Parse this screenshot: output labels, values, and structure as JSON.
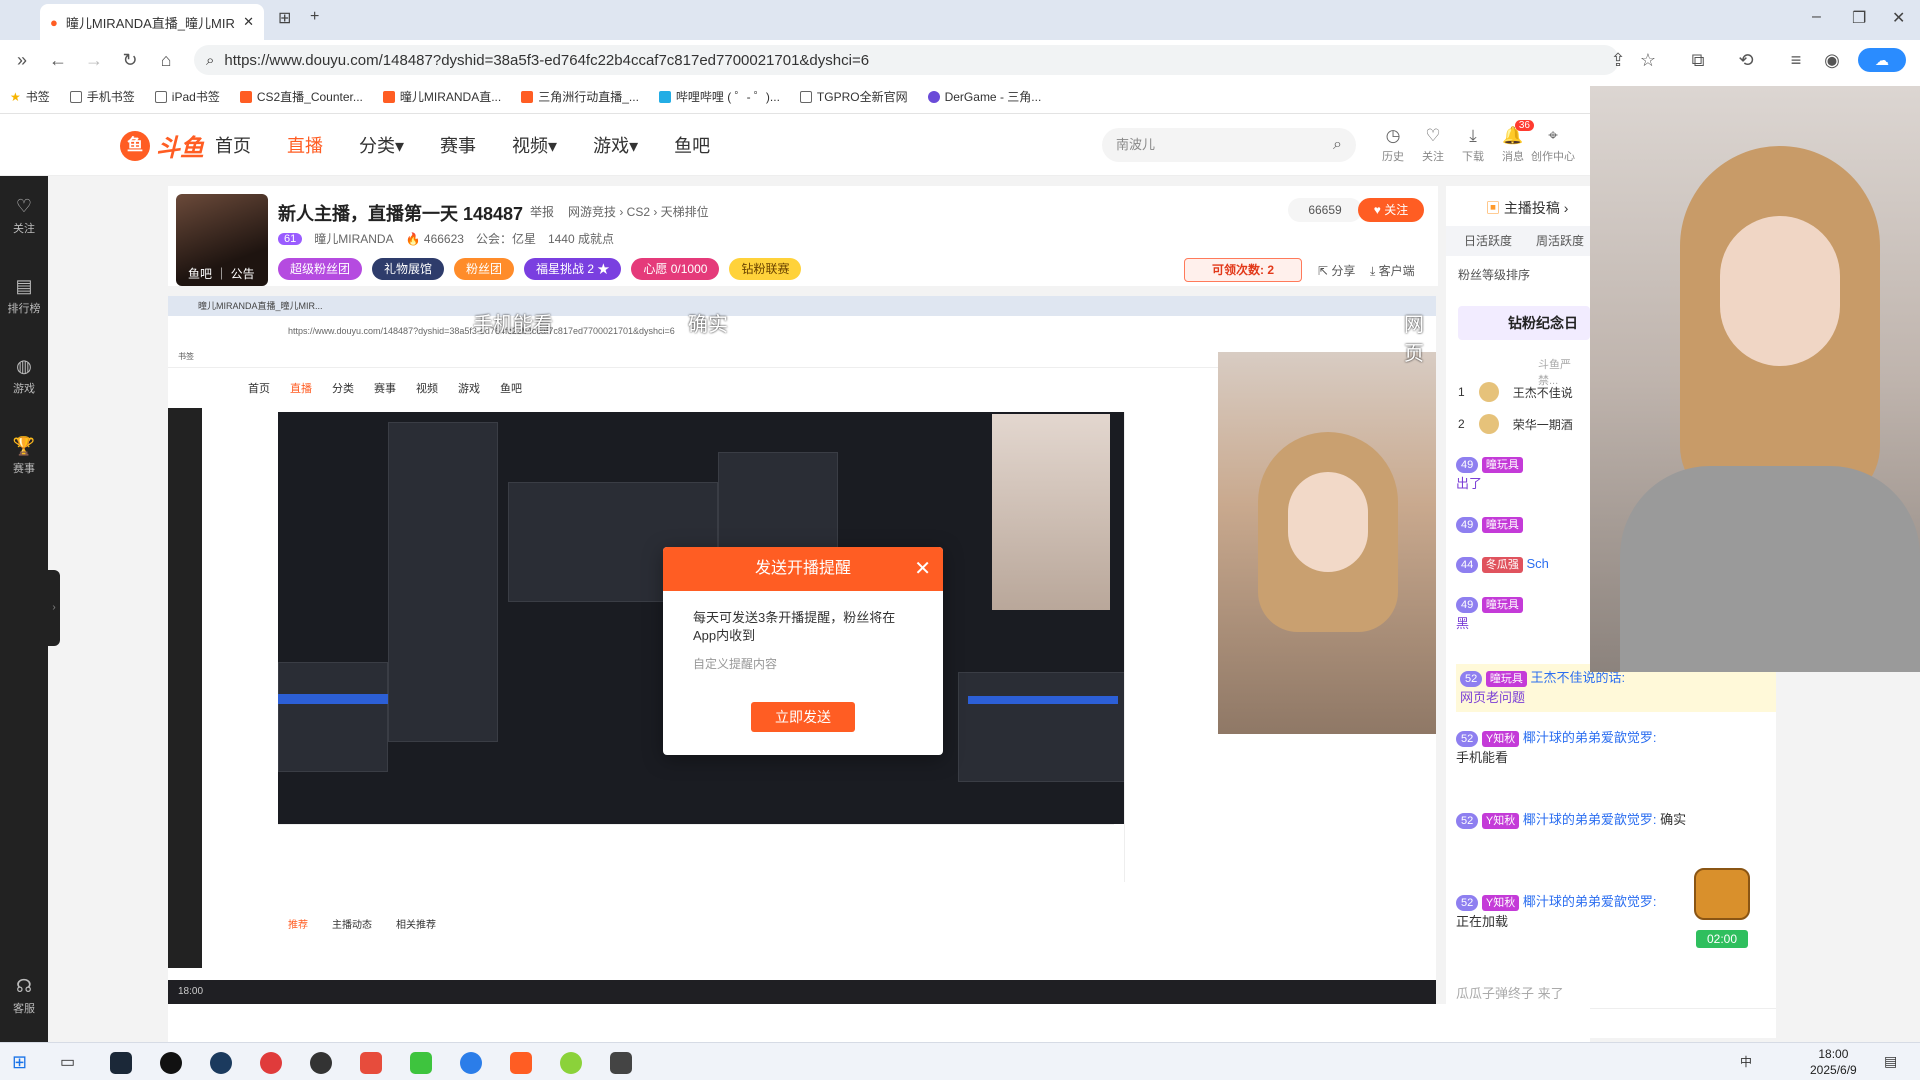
{
  "browser": {
    "tab_title": "曈儿MIRANDA直播_曈儿MIR...",
    "url": "https://www.douyu.com/148487?dyshid=38a5f3-ed764fc22b4ccaf7c817ed7700021701&dyshci=6",
    "bookmarks": [
      "书签",
      "手机书签",
      "iPad书签",
      "CS2直播_Counter...",
      "曈儿MIRANDA直...",
      "三角洲行动直播_...",
      "哔哩哔哩 ( ゜- ゜)...",
      "TGPRO全新官网",
      "DerGame - 三角..."
    ]
  },
  "site": {
    "logo_text": "斗鱼",
    "nav": [
      "首页",
      "直播",
      "分类▾",
      "赛事",
      "视频▾",
      "游戏▾",
      "鱼吧"
    ],
    "search_placeholder": "南波儿",
    "header_icons": [
      {
        "label": "历史",
        "icon": "clock-icon"
      },
      {
        "label": "关注",
        "icon": "heart-icon"
      },
      {
        "label": "下载",
        "icon": "download-icon"
      },
      {
        "label": "消息",
        "icon": "bell-icon"
      },
      {
        "label": "创作中心",
        "icon": "location-icon"
      }
    ],
    "message_count": "36",
    "sidebar": [
      "关注",
      "排行榜",
      "游戏",
      "赛事",
      "客服"
    ]
  },
  "anchor": {
    "room_title": "新人主播，直播第一天 148487",
    "report": "举报",
    "breadcrumbs": "网游竞技 › CS2 › 天梯排位",
    "level": "61",
    "name": "曈儿MIRANDA",
    "heat": "466623",
    "guild": "公会：亿星",
    "achievements": "1440 成就点",
    "avatar_label": "鱼吧 ｜ 公告",
    "hot": "66659",
    "follow": "关注",
    "tags": [
      "超级粉丝团",
      "礼物展馆",
      "粉丝团",
      "福星挑战 2 ★",
      "心愿 0/1000",
      "钻粉联赛"
    ],
    "fish_badge": "可领次数: 2",
    "share": "分享",
    "client": "客户端"
  },
  "player": {
    "danmu": [
      "手机能看",
      "确实",
      "网页"
    ],
    "inner_nav": [
      "首页",
      "直播",
      "分类",
      "赛事",
      "视频",
      "游戏",
      "鱼吧"
    ],
    "inner_tabs": [
      "推荐",
      "主播动态",
      "相关推荐"
    ]
  },
  "dialog": {
    "title": "发送开播提醒",
    "body": "每天可发送3条开播提醒，粉丝将在App内收到",
    "placeholder": "自定义提醒内容",
    "send": "立即发送"
  },
  "rank": {
    "title": "主播投稿",
    "tabs": [
      "日活跃度",
      "周活跃度"
    ],
    "sort": "粉丝等级排序",
    "fan_day": "钻粉纪念日",
    "rows": [
      {
        "rank": "1",
        "name": "王杰不佳说"
      },
      {
        "rank": "2",
        "name": "荣华一期酒"
      }
    ],
    "notice": "斗鱼严禁..."
  },
  "chat": [
    {
      "level": "49",
      "badge": "曈玩具",
      "name": "",
      "text": "出了"
    },
    {
      "level": "49",
      "badge": "曈玩具",
      "name": "",
      "text": ""
    },
    {
      "level": "44",
      "badge": "冬瓜强",
      "name": "Sch",
      "text": ""
    },
    {
      "level": "49",
      "badge": "曈玩具",
      "name": "",
      "text": "黑"
    },
    {
      "level": "52",
      "badge": "曈玩具",
      "name": "王杰不佳说的话:",
      "text": "网页老问题"
    },
    {
      "level": "52",
      "badge": "Y知秋",
      "name": "椰汁球的弟弟爱歆觉罗:",
      "text": "手机能看"
    },
    {
      "level": "52",
      "badge": "Y知秋",
      "name": "椰汁球的弟弟爱歆觉罗:",
      "text": "确实"
    },
    {
      "level": "52",
      "badge": "Y知秋",
      "name": "椰汁球的弟弟爱歆觉罗:",
      "text": "正在加载"
    }
  ],
  "chat_footer": "瓜瓜子弹终子 来了",
  "gift_timer": "02:00",
  "taskbar": {
    "time": "18:00",
    "date": "2025/6/9",
    "ime": "中"
  },
  "colors": {
    "brand": "#ff5d23",
    "sidebar": "#222222"
  }
}
